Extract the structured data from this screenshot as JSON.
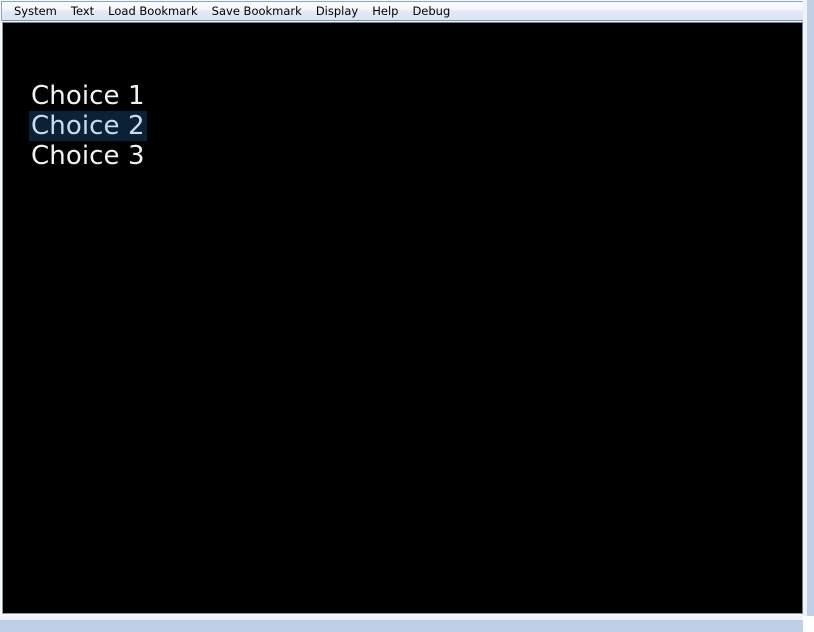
{
  "window": {
    "frame_color": "#bed0e6",
    "client_background": "#000000"
  },
  "menubar": {
    "items": [
      {
        "label": "System"
      },
      {
        "label": "Text"
      },
      {
        "label": "Load Bookmark"
      },
      {
        "label": "Save Bookmark"
      },
      {
        "label": "Display"
      },
      {
        "label": "Help"
      },
      {
        "label": "Debug"
      }
    ]
  },
  "content": {
    "text_color": "#f2f2f2",
    "selection_background": "#0b2236",
    "selection_text_color": "#c9dcee",
    "choices": [
      {
        "label": "Choice 1",
        "selected": false
      },
      {
        "label": "Choice 2",
        "selected": true
      },
      {
        "label": "Choice 3",
        "selected": false
      }
    ]
  }
}
